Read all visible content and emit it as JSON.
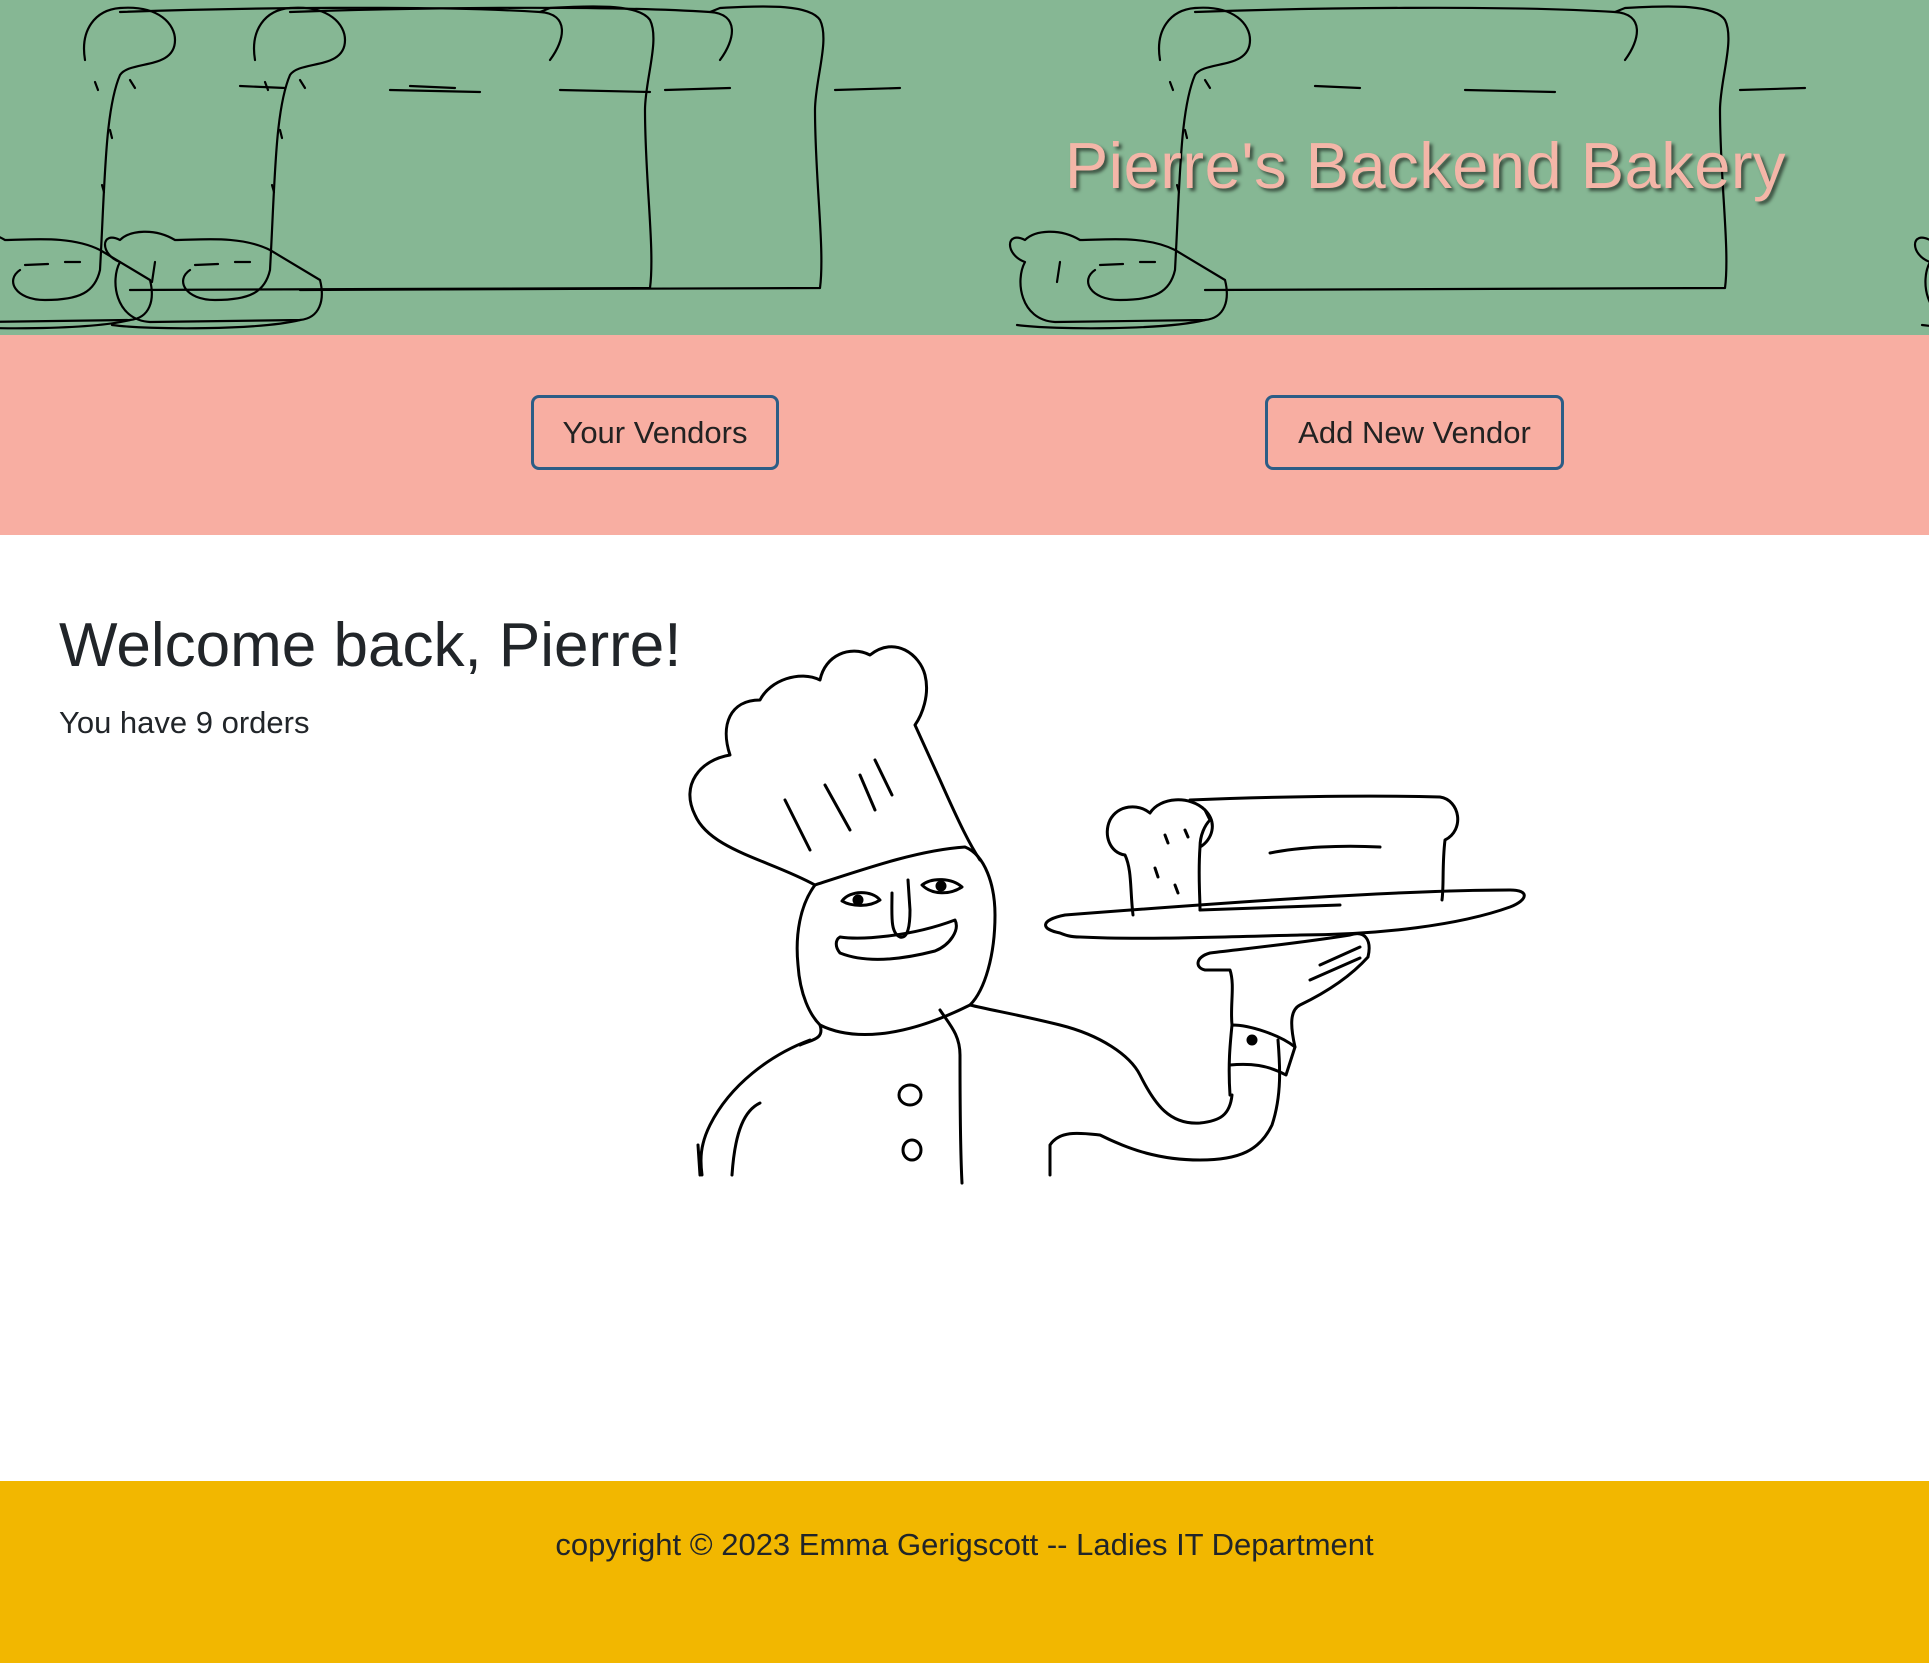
{
  "header": {
    "title": "Pierre's Backend Bakery"
  },
  "nav": {
    "vendors_label": "Your Vendors",
    "add_vendor_label": "Add New Vendor"
  },
  "main": {
    "welcome": "Welcome back, Pierre!",
    "orders_text": "You have 9 orders"
  },
  "footer": {
    "copyright": "copyright © 2023 Emma Gerigscott -- Ladies IT Department"
  },
  "colors": {
    "header_bg": "#86b794",
    "title_color": "#f4b6a8",
    "nav_bg": "#f8aea2",
    "button_border": "#2c5d86",
    "footer_bg": "#f2b700"
  },
  "icons": {
    "header_pattern": "bread-loaf-doodle",
    "main_illustration": "chef-holding-bread-doodle"
  }
}
